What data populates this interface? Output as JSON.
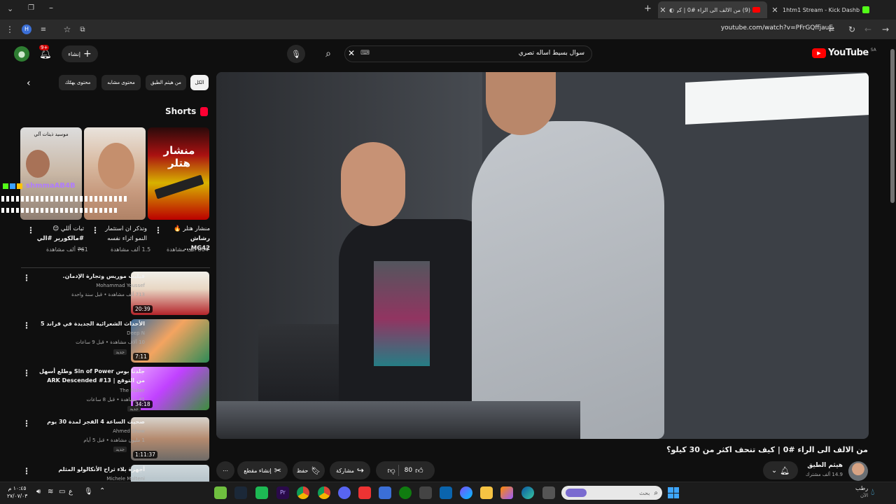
{
  "browser": {
    "tabs": [
      {
        "title": "1htm1 Stream - Kick Dashboard"
      },
      {
        "title": "(9) من الالف الى الراء #0 | كي..."
      }
    ],
    "url": "youtube.com/watch?v=PFrGQffjauE",
    "profile_letter": "H"
  },
  "header": {
    "logo_text": "YouTube",
    "region": "SA",
    "search_query": "سوال بسيط اساله تصري",
    "create_label": "إنشاء",
    "notif_count": "9+"
  },
  "chips": [
    "الكل",
    "من هيثم الطيق",
    "محتوى مشابه",
    "محتوى يهمّك"
  ],
  "shorts": {
    "heading": "Shorts",
    "overlay_user": "shmmaAB4B",
    "items": [
      {
        "title_l1": "منشار هتلر 🔥",
        "title_l2": "رشاش MG42...",
        "views": "864 ألف مشاهدة",
        "thumb_text": "منشار هتلر"
      },
      {
        "title_l1": "وتذكر ان استثمار",
        "title_l2": "النمو اثراء نفسه",
        "views": "1.5 ألف مشاهدة",
        "thumb_text": ""
      },
      {
        "title_l1": "ثبات أللي 😊",
        "title_l2": "#مالكورير #الي ...",
        "views": "761 ألف مشاهدة",
        "thumb_text": "موسيد ذينات آلي"
      }
    ]
  },
  "recs": [
    {
      "title": "فيليب موريس وتجارة الإدمان.",
      "channel": "Mohammad Youssef",
      "meta": "713 ألف مشاهدة • قبل سنة واحدة",
      "duration": "20:39",
      "badge": ""
    },
    {
      "title": "الأحداث الشعرائية الجديدة في قراند 5",
      "channel": "Deep N",
      "meta": "10 آلاف مشاهدة • قبل 9 ساعات",
      "duration": "7:11",
      "badge": "جديد"
    },
    {
      "title": "جلدنا بوس Sin of Power وطلع أسهل من التوقع | ARK Descended #13",
      "channel": "The Fisher",
      "meta": "41 مشاهدة • قبل 8 ساعات",
      "duration": "34:18",
      "badge": "جديد"
    },
    {
      "title": "صحيت الساعة 4 الفجر لمدة 30 يوم",
      "channel": "Ahmed Show",
      "meta": "1 مليون مشاهدة • قبل 5 أيام",
      "duration": "1:11:37",
      "badge": "جديد"
    },
    {
      "title": "أجهزة بلاء ثراح الأنكالولو المثلم",
      "channel": "Michele Molteni",
      "meta": "",
      "duration": "",
      "badge": ""
    }
  ],
  "video": {
    "title": "من الالف الى الراء #0 | كيف تنحف اكثر من 30 كيلو؟",
    "channel": "هيثم الطيق",
    "subs": "14.9 ألف مشترك",
    "likes": "80",
    "share": "مشاركة",
    "save": "حفظ",
    "clip": "إنشاء مقطع"
  },
  "taskbar": {
    "search_placeholder": "بحث",
    "time": "١٠:٤٥ م",
    "date": "٢٧/٠٧/٠٣",
    "weather": "رطب",
    "weather_sub": "الآن",
    "lang": "ع"
  },
  "colors": {
    "accent_red": "#ff0000",
    "bg": "#0f0f0f"
  }
}
